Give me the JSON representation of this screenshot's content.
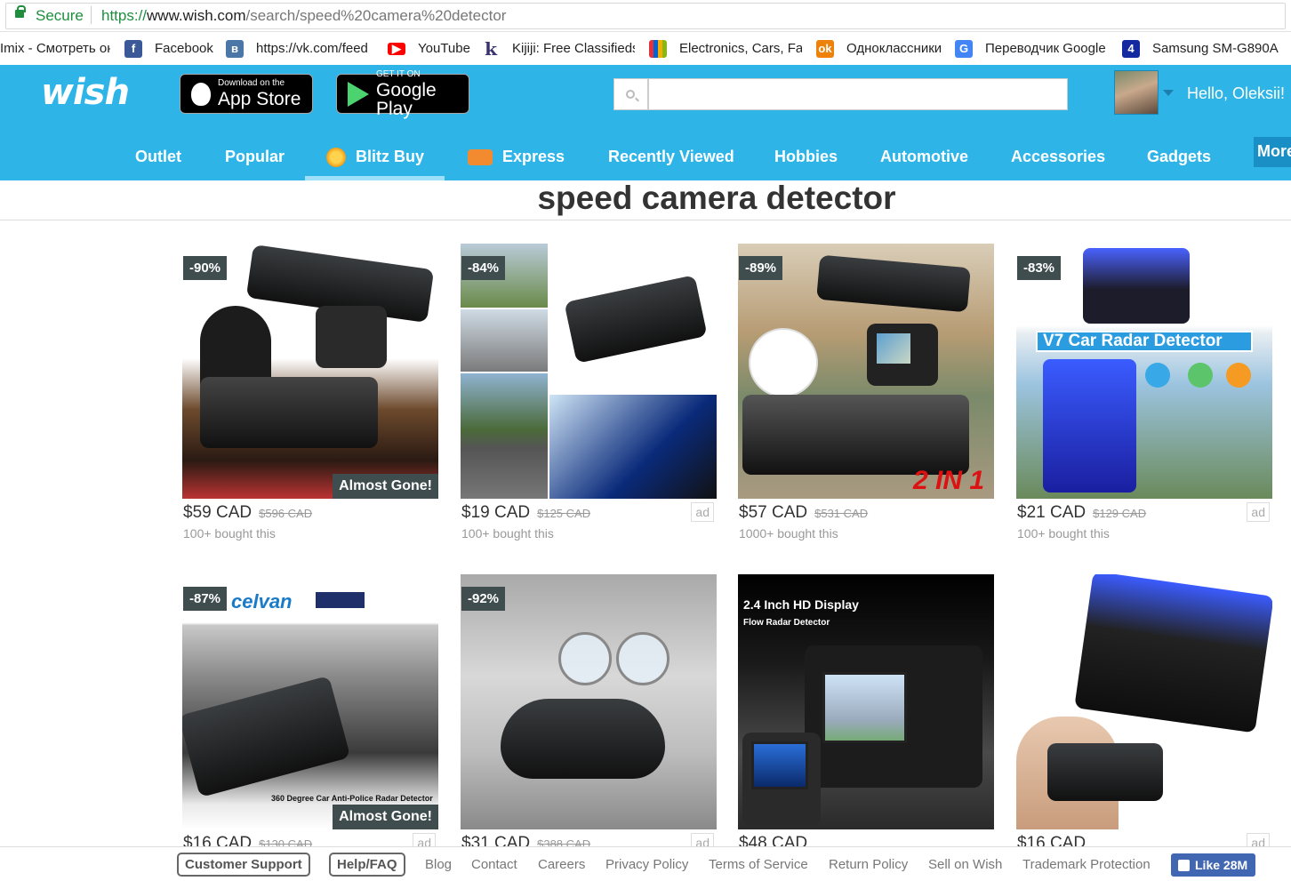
{
  "browser": {
    "secure_label": "Secure",
    "url_scheme": "https://",
    "url_host": "www.wish.com",
    "url_path": "/search/speed%20camera%20detector"
  },
  "bookmarks": [
    {
      "label": "Imix - Смотреть он",
      "icon": "page-icon"
    },
    {
      "label": "Facebook",
      "icon": "facebook-icon",
      "color": "#3b5998"
    },
    {
      "label": "https://vk.com/feed",
      "icon": "vk-icon",
      "color": "#4a76a8"
    },
    {
      "label": "YouTube",
      "icon": "youtube-icon",
      "color": "#ff0000"
    },
    {
      "label": "Kijiji: Free Classifieds",
      "icon": "kijiji-icon",
      "color": "#373373"
    },
    {
      "label": "Electronics, Cars, Fas",
      "icon": "ebay-icon"
    },
    {
      "label": "Одноклассники",
      "icon": "odnoklassniki-icon",
      "color": "#ee8208"
    },
    {
      "label": "Переводчик Google",
      "icon": "google-translate-icon",
      "color": "#4285f4"
    },
    {
      "label": "Samsung SM-G890A",
      "icon": "samsung-icon",
      "color": "#1428a0"
    }
  ],
  "header": {
    "logo_text": "wish",
    "app_store_small": "Download on the",
    "app_store_big": "App Store",
    "google_play_small": "GET IT ON",
    "google_play_big": "Google Play",
    "search_value": "",
    "greeting": "Hello, Oleksii!"
  },
  "nav": [
    {
      "label": "Outlet"
    },
    {
      "label": "Popular"
    },
    {
      "label": "Blitz Buy",
      "active": true,
      "icon": "blitz-icon"
    },
    {
      "label": "Express",
      "icon": "truck-icon"
    },
    {
      "label": "Recently Viewed"
    },
    {
      "label": "Hobbies"
    },
    {
      "label": "Automotive"
    },
    {
      "label": "Accessories"
    },
    {
      "label": "Gadgets"
    },
    {
      "label": "More"
    }
  ],
  "search_title": "speed camera detector",
  "products": [
    {
      "discount": "-90%",
      "price": "$59 CAD",
      "old_price": "$596 CAD",
      "bought": "100+ bought this",
      "badge": "Almost Gone!"
    },
    {
      "discount": "-84%",
      "price": "$19 CAD",
      "old_price": "$125 CAD",
      "bought": "100+ bought this",
      "ad": "ad"
    },
    {
      "discount": "-89%",
      "price": "$57 CAD",
      "old_price": "$531 CAD",
      "bought": "1000+ bought this",
      "image_text": "2 IN 1"
    },
    {
      "discount": "-83%",
      "price": "$21 CAD",
      "old_price": "$129 CAD",
      "bought": "100+ bought this",
      "ad": "ad",
      "image_text": "V7 Car Radar Detector"
    },
    {
      "discount": "-87%",
      "price": "$16 CAD",
      "old_price": "$130 CAD",
      "badge": "Almost Gone!",
      "ad": "ad",
      "image_text": "360 Degree Car Anti-Police Radar Detector"
    },
    {
      "discount": "-92%",
      "price": "$31 CAD",
      "old_price": "$388 CAD",
      "ad": "ad"
    },
    {
      "price": "$48 CAD",
      "image_text": "2.4 Inch HD Display",
      "image_subtext": "Flow Radar Detector"
    },
    {
      "price": "$16 CAD",
      "ad": "ad"
    }
  ],
  "footer": {
    "customer_support": "Customer Support",
    "help_faq": "Help/FAQ",
    "links": [
      "Blog",
      "Contact",
      "Careers",
      "Privacy Policy",
      "Terms of Service",
      "Return Policy",
      "Sell on Wish",
      "Trademark Protection"
    ],
    "like_label": "Like",
    "like_count": "28M"
  },
  "colors": {
    "header_blue": "#2fb4e8",
    "badge_dark": "#3f4d4f",
    "facebook_blue": "#4267b2"
  }
}
